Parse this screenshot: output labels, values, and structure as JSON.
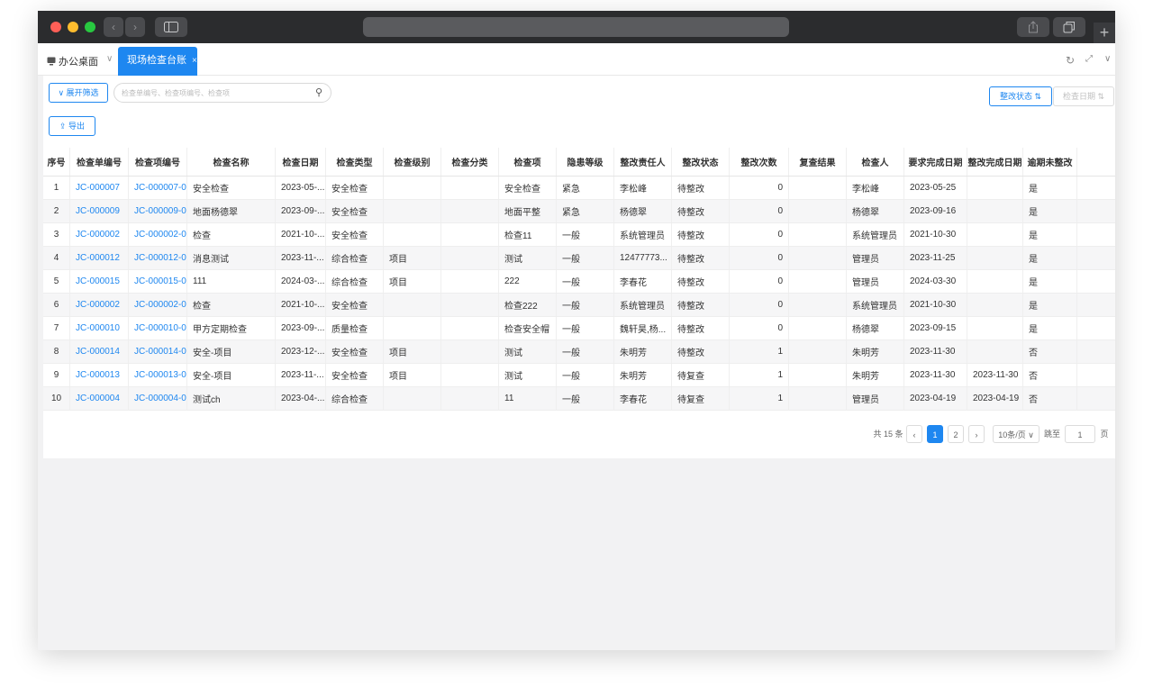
{
  "browser": {
    "nav_back": "‹",
    "nav_forward": "›",
    "new_tab": "+"
  },
  "tabs": {
    "home_label": "办公桌面",
    "active_label": "现场检查台账",
    "close": "×"
  },
  "toolbar": {
    "filter_label": "∨ 展开筛选",
    "search_placeholder": "检查单编号、检查项编号、检查项",
    "export_label": "导出",
    "sort_status_label": "整改状态",
    "sort_date_label": "检查日期"
  },
  "table": {
    "columns": [
      "序号",
      "检查单编号",
      "检查项编号",
      "检查名称",
      "检查日期",
      "检查类型",
      "检查级别",
      "检查分类",
      "检查项",
      "隐患等级",
      "整改责任人",
      "整改状态",
      "整改次数",
      "复查结果",
      "检查人",
      "要求完成日期",
      "整改完成日期",
      "逾期未整改"
    ],
    "rows": [
      [
        "1",
        "JC-000007",
        "JC-000007-01",
        "安全检查",
        "2023-05-...",
        "安全检查",
        "",
        "",
        "安全检查",
        "紧急",
        "李松峰",
        "待整改",
        "0",
        "",
        "李松峰",
        "2023-05-25",
        "",
        "是"
      ],
      [
        "2",
        "JC-000009",
        "JC-000009-01",
        "地面杨德翠",
        "2023-09-...",
        "安全检查",
        "",
        "",
        "地面平整",
        "紧急",
        "杨德翠",
        "待整改",
        "0",
        "",
        "杨德翠",
        "2023-09-16",
        "",
        "是"
      ],
      [
        "3",
        "JC-000002",
        "JC-000002-01",
        "检查",
        "2021-10-...",
        "安全检查",
        "",
        "",
        "检查11",
        "一般",
        "系统管理员",
        "待整改",
        "0",
        "",
        "系统管理员",
        "2021-10-30",
        "",
        "是"
      ],
      [
        "4",
        "JC-000012",
        "JC-000012-01",
        "消息测试",
        "2023-11-...",
        "综合检查",
        "项目",
        "",
        "测试",
        "一般",
        "12477773...",
        "待整改",
        "0",
        "",
        "管理员",
        "2023-11-25",
        "",
        "是"
      ],
      [
        "5",
        "JC-000015",
        "JC-000015-01",
        "111",
        "2024-03-...",
        "综合检查",
        "项目",
        "",
        "222",
        "一般",
        "李春花",
        "待整改",
        "0",
        "",
        "管理员",
        "2024-03-30",
        "",
        "是"
      ],
      [
        "6",
        "JC-000002",
        "JC-000002-02",
        "检查",
        "2021-10-...",
        "安全检查",
        "",
        "",
        "检查222",
        "一般",
        "系统管理员",
        "待整改",
        "0",
        "",
        "系统管理员",
        "2021-10-30",
        "",
        "是"
      ],
      [
        "7",
        "JC-000010",
        "JC-000010-02",
        "甲方定期检查",
        "2023-09-...",
        "质量检查",
        "",
        "",
        "检查安全帽",
        "一般",
        "魏轩昊,杨...",
        "待整改",
        "0",
        "",
        "杨德翠",
        "2023-09-15",
        "",
        "是"
      ],
      [
        "8",
        "JC-000014",
        "JC-000014-01",
        "安全-项目",
        "2023-12-...",
        "安全检查",
        "项目",
        "",
        "测试",
        "一般",
        "朱明芳",
        "待整改",
        "1",
        "",
        "朱明芳",
        "2023-11-30",
        "",
        "否"
      ],
      [
        "9",
        "JC-000013",
        "JC-000013-01",
        "安全-项目",
        "2023-11-...",
        "安全检查",
        "项目",
        "",
        "测试",
        "一般",
        "朱明芳",
        "待复查",
        "1",
        "",
        "朱明芳",
        "2023-11-30",
        "2023-11-30",
        "否"
      ],
      [
        "10",
        "JC-000004",
        "JC-000004-01",
        "测试ch",
        "2023-04-...",
        "综合检查",
        "",
        "",
        "11",
        "一般",
        "李春花",
        "待复查",
        "1",
        "",
        "管理员",
        "2023-04-19",
        "2023-04-19",
        "否"
      ]
    ]
  },
  "pagination": {
    "total_label": "共 15 条",
    "prev": "‹",
    "pages": [
      "1",
      "2"
    ],
    "current_page": "1",
    "next": "›",
    "page_size": "10条/页",
    "jump_label": "跳至",
    "jump_value": "1",
    "page_unit": "页"
  },
  "colors": {
    "accent": "#1e87f0",
    "titlebar": "#2b2c2e"
  }
}
